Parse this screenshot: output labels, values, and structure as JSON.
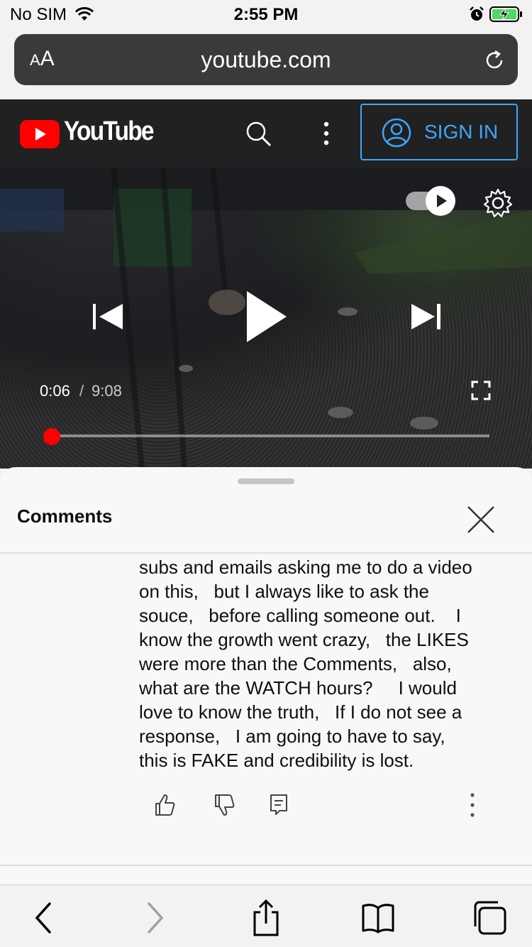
{
  "status_bar": {
    "carrier": "No SIM",
    "time": "2:55 PM",
    "icons": [
      "wifi-icon",
      "alarm-icon",
      "battery-charging-icon"
    ]
  },
  "browser": {
    "text_size_small": "A",
    "text_size_large": "A",
    "url": "youtube.com",
    "reload_icon": "reload-icon"
  },
  "youtube_header": {
    "logo_text": "YouTube",
    "sign_in_label": "SIGN IN",
    "icons": [
      "search-icon",
      "more-vertical-icon",
      "account-icon"
    ],
    "accent_color": "#3ea6ff",
    "brand_color": "#ff0000"
  },
  "player": {
    "current_time": "0:06",
    "separator": "/",
    "duration": "9:08",
    "progress_fraction": 0.011,
    "autoplay_on": true,
    "icons": [
      "previous-icon",
      "play-icon",
      "next-icon",
      "fullscreen-icon",
      "settings-icon",
      "autoplay-toggle-icon"
    ]
  },
  "comments_sheet": {
    "title": "Comments",
    "comment_text": "subs and emails asking me to do a video\non this,   but I always like to ask the\nsouce,   before calling someone out.    I\nknow the growth went crazy,   the LIKES\nwere more than the Comments,   also,\nwhat are the WATCH hours?     I would\nlove to know the truth,   If I do not see a\nresponse,   I am going to have to say,\nthis is FAKE and credibility is lost.",
    "actions": [
      "like-icon",
      "dislike-icon",
      "reply-icon",
      "more-vertical-icon"
    ]
  },
  "safari_toolbar": {
    "icons": [
      "back-icon",
      "forward-icon",
      "share-icon",
      "bookmarks-icon",
      "tabs-icon"
    ]
  }
}
